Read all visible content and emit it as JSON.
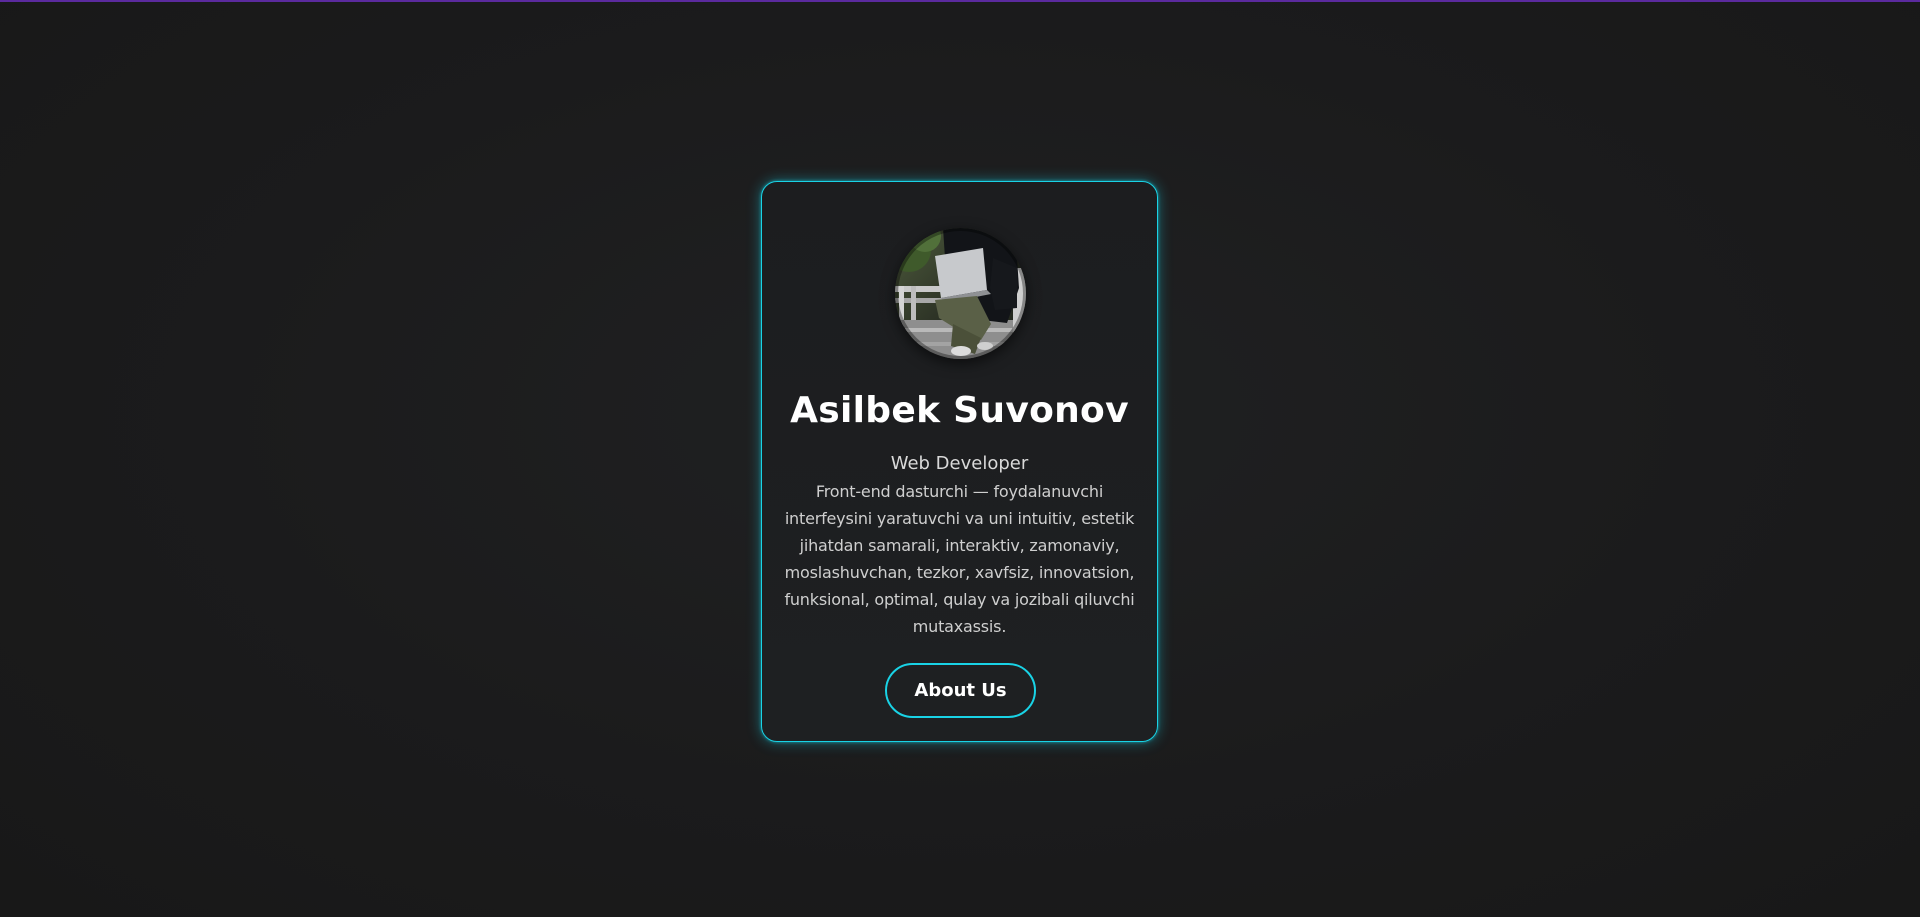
{
  "profile": {
    "name": "Asilbek Suvonov",
    "role": "Web Developer",
    "bio": "Front-end dasturchi — foydalanuvchi interfeysini yaratuvchi va uni intuitiv, estetik jihatdan samarali, interaktiv, zamonaviy, moslashuvchan, tezkor, xavfsiz, innovatsion, funksional, optimal, qulay va jozibali qiluvchi mutaxassis.",
    "button_label": "About Us",
    "avatar_icon": "profile-photo"
  },
  "colors": {
    "accent": "#19d3e6",
    "background": "#1b1b1c",
    "top_bar": "#5b2a9e",
    "text": "#ffffff"
  }
}
